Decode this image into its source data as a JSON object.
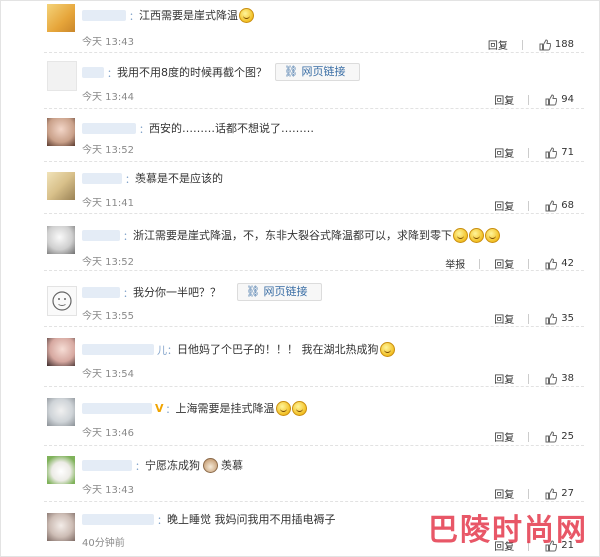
{
  "ui": {
    "reply_label": "回复",
    "report_label": "举报",
    "weblink_label": "网页链接"
  },
  "comments": [
    {
      "user": "：",
      "text": "江西需要是崖式降温",
      "time": "今天 13:43",
      "likes": "188"
    },
    {
      "user": "：",
      "text": "我用不用8度的时候再截个图？",
      "time": "今天 13:44",
      "likes": "94"
    },
    {
      "user": "：",
      "text": "西安的………话都不想说了………",
      "time": "今天 13:52",
      "likes": "71"
    },
    {
      "user": "：",
      "text": "羡慕是不是应该的",
      "time": "今天 11:41",
      "likes": "68"
    },
    {
      "user": "：",
      "text": "浙江需要是崖式降温，不，东非大裂谷式降温都可以，求降到零下",
      "time": "今天 13:52",
      "likes": "42"
    },
    {
      "user": "：",
      "text": "我分你一半吧？？",
      "time": "今天 13:55",
      "likes": "35"
    },
    {
      "user": "儿：",
      "text": "日他妈了个巴子的！！！ 我在湖北热成狗",
      "time": "今天 13:54",
      "likes": "38"
    },
    {
      "user": "：",
      "text": "上海需要是挂式降温",
      "time": "今天 13:46",
      "likes": "25"
    },
    {
      "user": "：",
      "text_a": "宁愿冻成狗",
      "text_b": "羡慕",
      "time": "今天 13:43",
      "likes": "27"
    },
    {
      "user": "：",
      "text": "晚上睡觉 我妈问我用不用插电褥子",
      "time": "40分钟前",
      "likes": "21"
    }
  ],
  "watermark": "巴陵时尚网",
  "icons": [
    "laugh-cry-emoji",
    "link-icon",
    "thumbs-up-icon",
    "dog-emoji",
    "v-badge"
  ]
}
